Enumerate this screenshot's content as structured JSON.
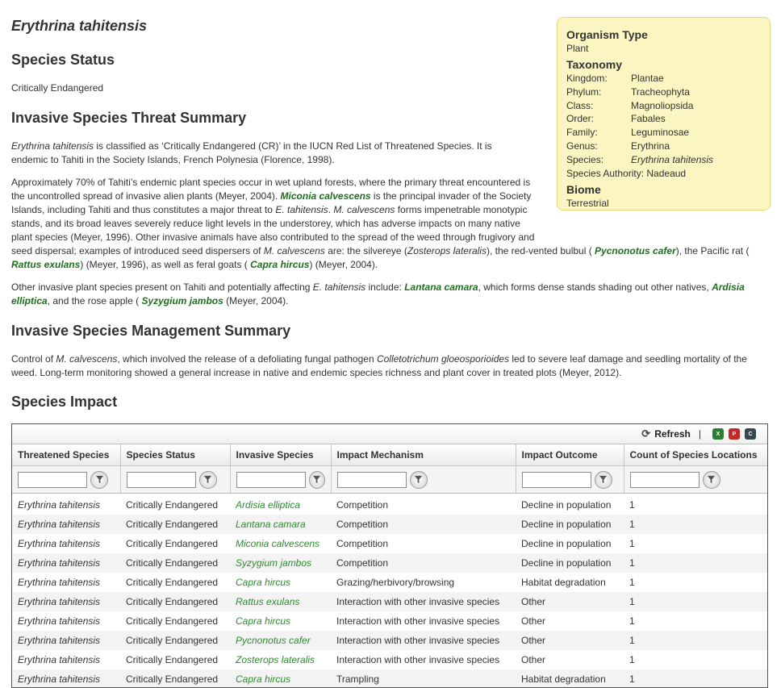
{
  "species_title": "Erythrina tahitensis",
  "species_status": {
    "heading": "Species Status",
    "value": "Critically Endangered"
  },
  "threat_summary": {
    "heading": "Invasive Species Threat Summary",
    "p1": {
      "a": "Erythrina tahitensis",
      "b": " is classified as ‘Critically Endangered (CR)’ in the IUCN Red List of Threatened Species. It is endemic to Tahiti in the Society Islands, French Polynesia (Florence, 1998)."
    },
    "p2": {
      "a": "Approximately 70% of Tahiti’s endemic plant species occur in wet upland forests, where the primary threat encountered is the uncontrolled spread of invasive alien plants (Meyer, 2004). ",
      "b": "Miconia calvescens",
      "c": " is the principal invader of the Society Islands, including Tahiti and thus constitutes a major threat to ",
      "d": "E. tahitensis",
      "e": ". ",
      "f": "M. calvescens",
      "g": " forms impenetrable monotypic stands, and its broad leaves severely reduce light levels in the understorey, which has adverse impacts on many native plant species (Meyer, 1996). Other invasive animals have also contributed to the spread of the weed through frugivory and seed dispersal; examples of introduced seed dispersers of ",
      "h": "M. calvescens",
      "i": " are: the silvereye (",
      "j": "Zosterops lateralis",
      "k": "), the red-vented bulbul ( ",
      "l": "Pycnonotus cafer",
      "m": "), the Pacific rat ( ",
      "n": "Rattus exulans",
      "o": ") (Meyer, 1996), as well as feral goats ( ",
      "p": "Capra hircus",
      "q": ") (Meyer, 2004)."
    },
    "p3": {
      "a": "Other invasive plant species present on Tahiti and potentially affecting ",
      "b": "E. tahitensis",
      "c": " include: ",
      "d": "Lantana camara",
      "e": ", which forms dense stands shading out other natives, ",
      "f": "Ardisia elliptica",
      "g": ", and the rose apple ( ",
      "h": "Syzygium jambos",
      "i": " (Meyer, 2004)."
    }
  },
  "management_summary": {
    "heading": "Invasive Species Management Summary",
    "p1": {
      "a": "Control of ",
      "b": "M. calvescens",
      "c": ", which involved the release of a defoliating fungal pathogen ",
      "d": "Colletotrichum gloeosporioides",
      "e": " led to severe leaf damage and seedling mortality of the weed. Long-term monitoring showed a general increase in native and endemic species richness and plant cover in treated plots (Meyer, 2012)."
    }
  },
  "species_impact": {
    "heading": "Species Impact"
  },
  "infobox": {
    "organism_type_heading": "Organism Type",
    "organism_type": "Plant",
    "taxonomy_heading": "Taxonomy",
    "taxonomy": [
      {
        "key": "Kingdom:",
        "value": "Plantae"
      },
      {
        "key": "Phylum:",
        "value": "Tracheophyta"
      },
      {
        "key": "Class:",
        "value": "Magnoliopsida"
      },
      {
        "key": "Order:",
        "value": "Fabales"
      },
      {
        "key": "Family:",
        "value": "Leguminosae"
      },
      {
        "key": "Genus:",
        "value": "Erythrina"
      },
      {
        "key": "Species:",
        "value": "Erythrina tahitensis"
      }
    ],
    "authority": "Species Authority: Nadeaud",
    "biome_heading": "Biome",
    "biome": "Terrestrial"
  },
  "grid": {
    "refresh_label": "Refresh",
    "separator": "|",
    "export_icons": [
      "excel-export-icon",
      "pdf-export-icon",
      "csv-export-icon"
    ],
    "columns": [
      "Threatened Species",
      "Species Status",
      "Invasive Species",
      "Impact Mechanism",
      "Impact Outcome",
      "Count of Species Locations"
    ],
    "rows": [
      [
        "Erythrina tahitensis",
        "Critically Endangered",
        "Ardisia elliptica",
        "Competition",
        "Decline in population",
        "1"
      ],
      [
        "Erythrina tahitensis",
        "Critically Endangered",
        "Lantana camara",
        "Competition",
        "Decline in population",
        "1"
      ],
      [
        "Erythrina tahitensis",
        "Critically Endangered",
        "Miconia calvescens",
        "Competition",
        "Decline in population",
        "1"
      ],
      [
        "Erythrina tahitensis",
        "Critically Endangered",
        "Syzygium jambos",
        "Competition",
        "Decline in population",
        "1"
      ],
      [
        "Erythrina tahitensis",
        "Critically Endangered",
        "Capra hircus",
        "Grazing/herbivory/browsing",
        "Habitat degradation",
        "1"
      ],
      [
        "Erythrina tahitensis",
        "Critically Endangered",
        "Rattus exulans",
        "Interaction with other invasive species",
        "Other",
        "1"
      ],
      [
        "Erythrina tahitensis",
        "Critically Endangered",
        "Capra hircus",
        "Interaction with other invasive species",
        "Other",
        "1"
      ],
      [
        "Erythrina tahitensis",
        "Critically Endangered",
        "Pycnonotus cafer",
        "Interaction with other invasive species",
        "Other",
        "1"
      ],
      [
        "Erythrina tahitensis",
        "Critically Endangered",
        "Zosterops lateralis",
        "Interaction with other invasive species",
        "Other",
        "1"
      ],
      [
        "Erythrina tahitensis",
        "Critically Endangered",
        "Capra hircus",
        "Trampling",
        "Habitat degradation",
        "1"
      ]
    ]
  },
  "colors": {
    "link": "#1f6f1f",
    "infobox_bg": "#fbf5c1",
    "infobox_border": "#e6d97c"
  }
}
